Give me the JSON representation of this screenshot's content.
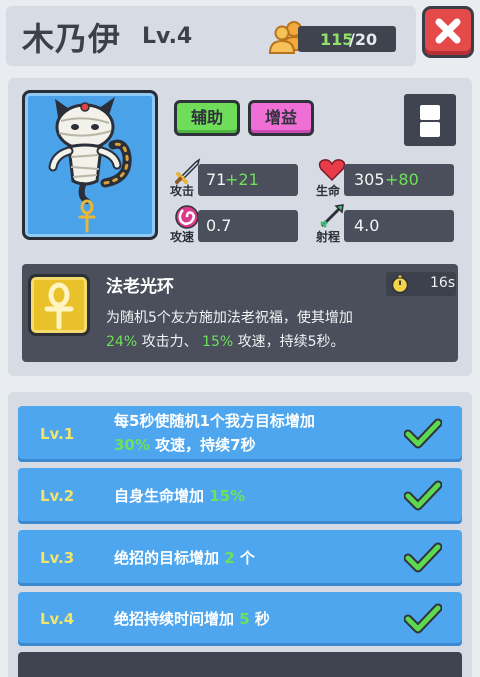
{
  "header": {
    "name": "木乃伊",
    "level": "Lv.4",
    "copies_have": "115",
    "copies_sep_need": "/20",
    "copies_icon": "hero-copies-icon",
    "close_icon": "close-x-icon"
  },
  "tags": {
    "support": "辅助",
    "buff": "增益"
  },
  "menu_icon": "menu-icon",
  "stats": {
    "attack": {
      "label": "攻击",
      "value": "71",
      "bonus": "+21",
      "icon": "sword-icon"
    },
    "health": {
      "label": "生命",
      "value": "305",
      "bonus": "+80",
      "icon": "heart-icon"
    },
    "speed": {
      "label": "攻速",
      "value": "0.7",
      "icon": "swirl-icon"
    },
    "range": {
      "label": "射程",
      "value": "4.0",
      "icon": "bow-arrow-icon"
    }
  },
  "skill": {
    "name": "法老光环",
    "cooldown": "16s",
    "icon": "ankh-icon",
    "desc_line1": "为随机5个友方施加法老祝福，使其增加",
    "desc_v1": "24%",
    "desc_mid": " 攻击力、 ",
    "desc_v2": "15%",
    "desc_end": " 攻速，持续5秒。"
  },
  "levels": [
    {
      "label": "Lv.1",
      "text_a": "每5秒使随机1个我方目标增加",
      "value": "30%",
      "text_b": " 攻速，持续7秒",
      "done": true
    },
    {
      "label": "Lv.2",
      "text_a": "自身生命增加 ",
      "value": "15%",
      "text_b": "",
      "done": true
    },
    {
      "label": "Lv.3",
      "text_a": "绝招的目标增加 ",
      "value": "2",
      "text_b": " 个",
      "done": true
    },
    {
      "label": "Lv.4",
      "text_a": "绝招持续时间增加 ",
      "value": "5",
      "text_b": " 秒",
      "done": true
    }
  ],
  "colors": {
    "accent_green": "#6fe05a",
    "level_gold": "#f2e36a",
    "row_blue": "#4ea6ee",
    "close_red": "#e44a4a"
  }
}
